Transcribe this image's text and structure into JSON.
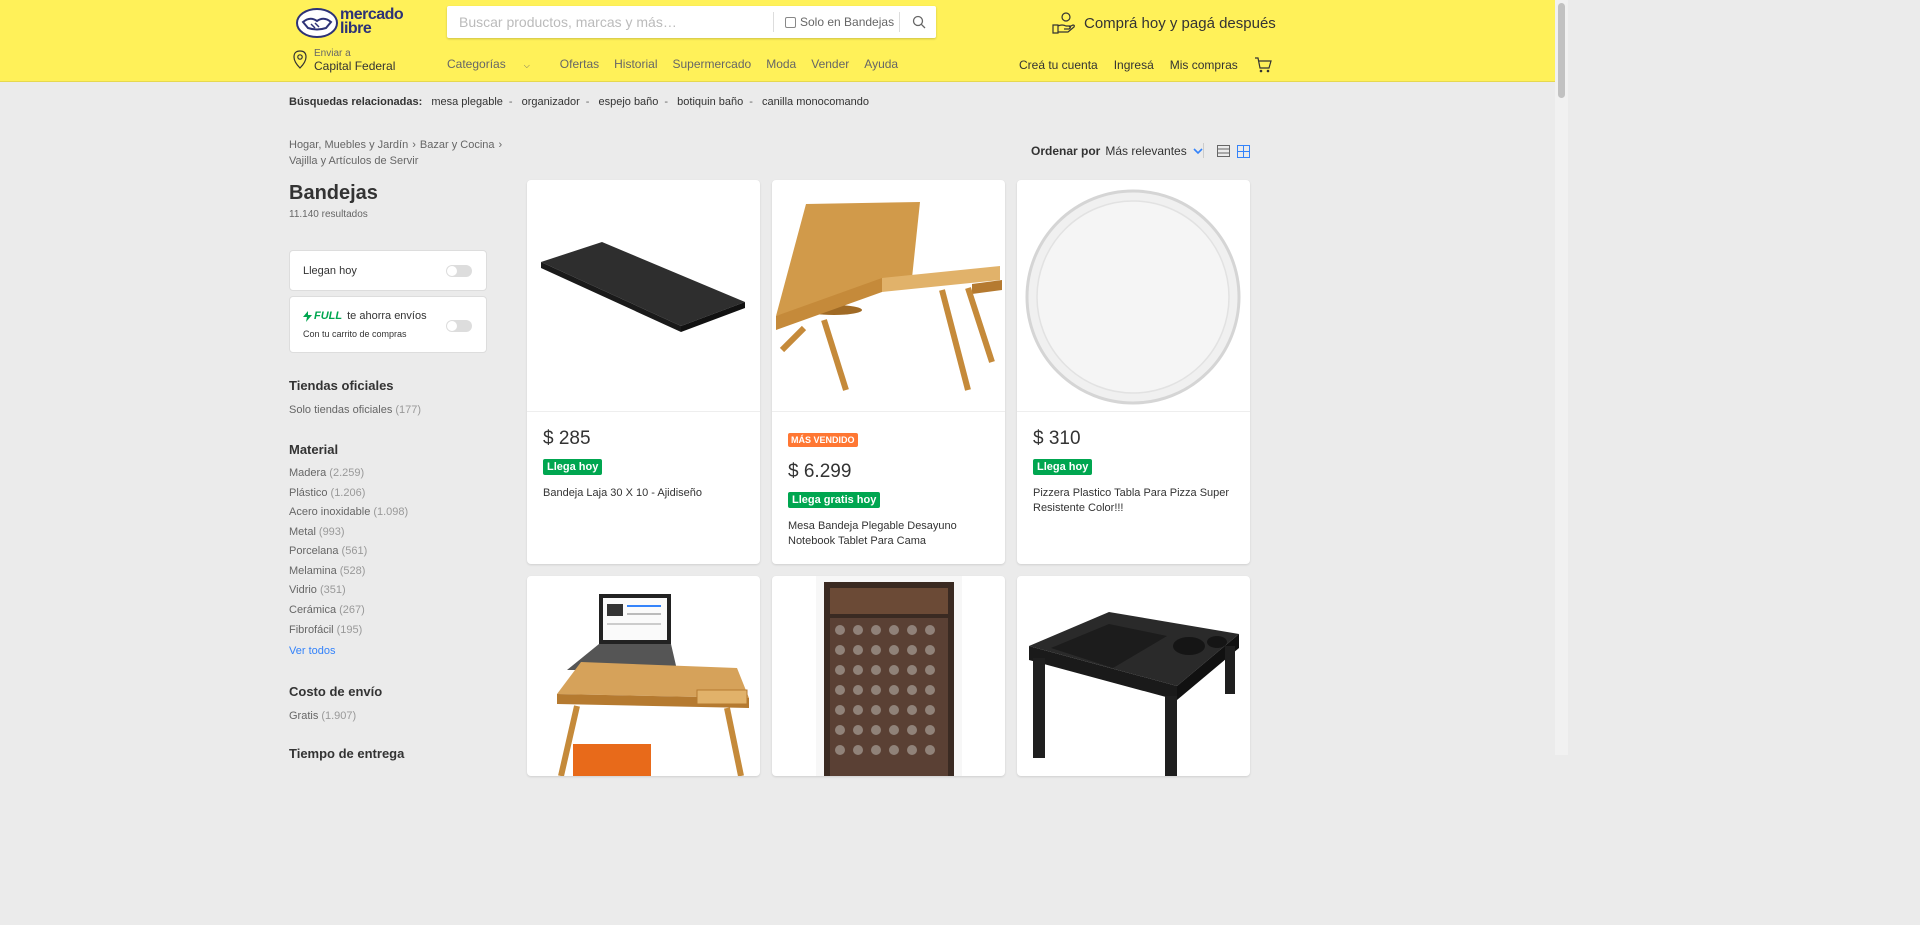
{
  "header": {
    "logo_line1": "mercado",
    "logo_line2": "libre",
    "search_placeholder": "Buscar productos, marcas y más…",
    "only_store_label": "Solo en Bandejas",
    "promo": "Comprá hoy y pagá después",
    "location_small": "Enviar a",
    "location_big": "Capital Federal",
    "nav": [
      "Categorías",
      "Ofertas",
      "Historial",
      "Supermercado",
      "Moda",
      "Vender",
      "Ayuda"
    ],
    "account": [
      "Creá tu cuenta",
      "Ingresá",
      "Mis compras"
    ]
  },
  "related": {
    "label": "Búsquedas relacionadas:",
    "items": [
      "mesa plegable",
      "organizador",
      "espejo baño",
      "botiquin baño",
      "canilla monocomando"
    ]
  },
  "breadcrumb": [
    "Hogar, Muebles y Jardín",
    "Bazar y Cocina",
    "Vajilla y Artículos de Servir"
  ],
  "sort": {
    "label": "Ordenar por",
    "value": "Más relevantes"
  },
  "page": {
    "title": "Bandejas",
    "results": "11.140 resultados"
  },
  "filters": {
    "arrive_today": "Llegan hoy",
    "full_brand": "FULL",
    "full_text": "te ahorra envíos",
    "full_sub": "Con tu carrito de compras",
    "official_title": "Tiendas oficiales",
    "official_item": "Solo tiendas oficiales",
    "official_count": "(177)",
    "material_title": "Material",
    "materials": [
      {
        "name": "Madera",
        "count": "(2.259)"
      },
      {
        "name": "Plástico",
        "count": "(1.206)"
      },
      {
        "name": "Acero inoxidable",
        "count": "(1.098)"
      },
      {
        "name": "Metal",
        "count": "(993)"
      },
      {
        "name": "Porcelana",
        "count": "(561)"
      },
      {
        "name": "Melamina",
        "count": "(528)"
      },
      {
        "name": "Vidrio",
        "count": "(351)"
      },
      {
        "name": "Cerámica",
        "count": "(267)"
      },
      {
        "name": "Fibrofácil",
        "count": "(195)"
      }
    ],
    "see_all": "Ver todos",
    "shipping_title": "Costo de envío",
    "shipping_item": "Gratis",
    "shipping_count": "(1.907)",
    "delivery_title": "Tiempo de entrega"
  },
  "products": [
    {
      "price": "$ 285",
      "badge": "Llega hoy",
      "title": "Bandeja Laja 30 X 10 - Ajidiseño"
    },
    {
      "tag": "MÁS VENDIDO",
      "price": "$ 6.299",
      "badge": "Llega gratis hoy",
      "title": "Mesa Bandeja Plegable Desayuno Notebook Tablet Para Cama"
    },
    {
      "price": "$ 310",
      "badge": "Llega hoy",
      "title": "Pizzera Plastico Tabla Para Pizza Super Resistente Color!!!"
    }
  ]
}
